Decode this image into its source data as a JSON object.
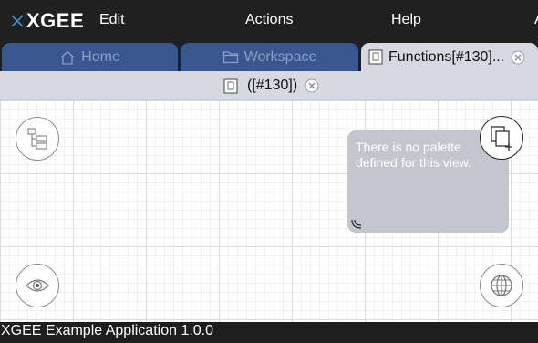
{
  "app": {
    "logo_text": "XGEE",
    "brand_color": "#3a8fd1"
  },
  "menu": {
    "edit": "Edit",
    "actions": "Actions",
    "help": "Help",
    "more": "A"
  },
  "tabs": [
    {
      "label": "Home",
      "icon": "home-icon",
      "active": false
    },
    {
      "label": "Workspace",
      "icon": "folder-icon",
      "active": false
    },
    {
      "label": "Functions[#130]...",
      "icon": "document-icon",
      "active": true,
      "closable": true
    }
  ],
  "subtab": {
    "label": "([#130])",
    "icon": "document-icon",
    "closable": true
  },
  "canvas": {
    "buttons": {
      "outline": "outline-tree-icon",
      "view": "eye-icon",
      "globe": "globe-icon",
      "palette": "palette-copy-add-icon"
    }
  },
  "palette": {
    "message": "There is no palette defined for this view."
  },
  "status": {
    "text": "XGEE Example Application 1.0.0"
  },
  "colors": {
    "menubar_bg": "#202020",
    "tab_inactive_bg": "#38578f",
    "tab_inactive_text": "#8a9fc4",
    "tab_active_bg": "#d7d9e2",
    "palette_bg": "#c4c6cf"
  }
}
